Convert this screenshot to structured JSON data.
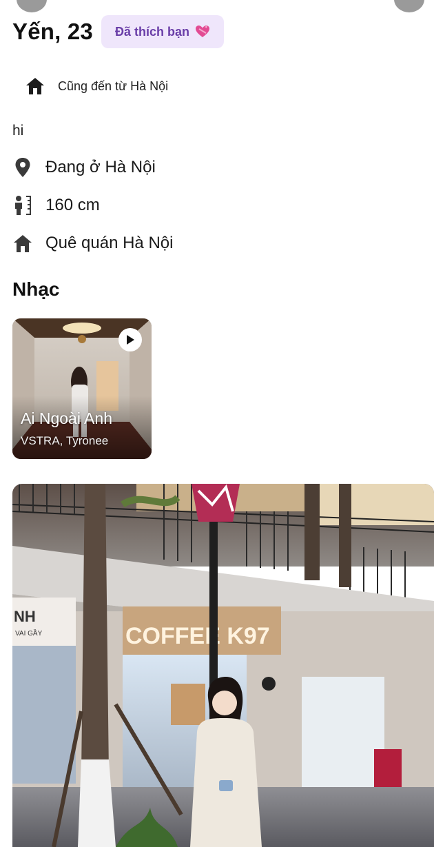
{
  "profile": {
    "name_age": "Yến, 23",
    "liked_badge": "Đã thích bạn",
    "liked_icon": "heart-gift-icon",
    "from_label": "Cũng đến từ Hà Nội",
    "bio": "hi",
    "location": "Đang ở Hà Nội",
    "height": "160 cm",
    "hometown": "Quê quán Hà Nội"
  },
  "music": {
    "section_title": "Nhạc",
    "song_title": "Ai Ngoài Anh",
    "artist": "VSTRA, Tyronee"
  },
  "photo": {
    "sign_coffee": "COFFEE K97",
    "sign_left": "NH",
    "sign_left_sub": "VAI GẦY"
  },
  "colors": {
    "badge_bg": "#efe6fb",
    "badge_text": "#6a3ea8",
    "icon": "#1c1c1c"
  }
}
